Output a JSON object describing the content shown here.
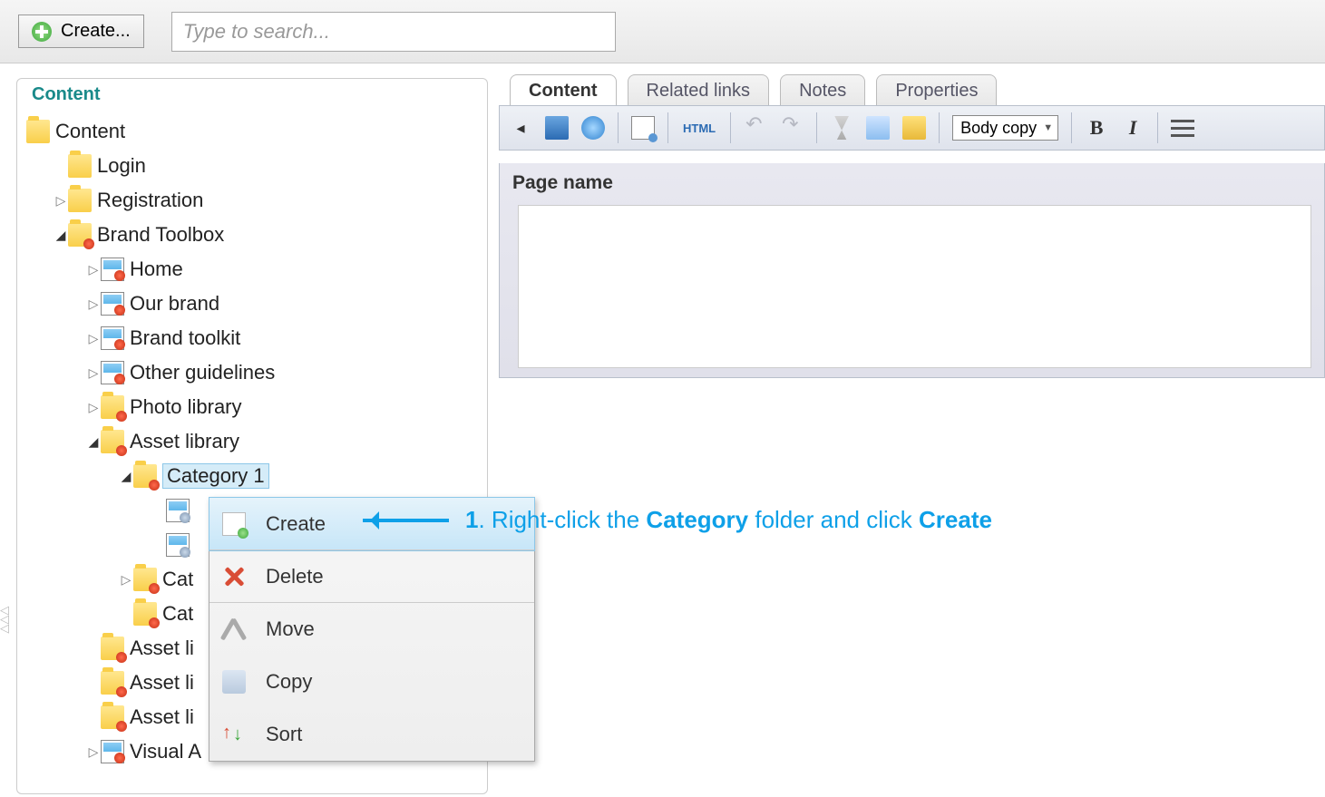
{
  "topbar": {
    "create_label": "Create...",
    "search_placeholder": "Type to search..."
  },
  "left_panel": {
    "title": "Content"
  },
  "tree": {
    "root": "Content",
    "items": [
      {
        "label": "Login",
        "indent": 1,
        "icon": "folder",
        "arrow": "none"
      },
      {
        "label": "Registration",
        "indent": 1,
        "icon": "folder",
        "arrow": "collapsed"
      },
      {
        "label": "Brand Toolbox",
        "indent": 1,
        "icon": "folder-red",
        "arrow": "expanded"
      },
      {
        "label": "Home",
        "indent": 2,
        "icon": "pic",
        "arrow": "collapsed"
      },
      {
        "label": "Our brand",
        "indent": 2,
        "icon": "pic",
        "arrow": "collapsed"
      },
      {
        "label": "Brand toolkit",
        "indent": 2,
        "icon": "pic",
        "arrow": "collapsed"
      },
      {
        "label": "Other guidelines",
        "indent": 2,
        "icon": "pic",
        "arrow": "collapsed"
      },
      {
        "label": "Photo library",
        "indent": 2,
        "icon": "folder-red",
        "arrow": "collapsed"
      },
      {
        "label": "Asset library",
        "indent": 2,
        "icon": "folder-red",
        "arrow": "expanded"
      },
      {
        "label": "Category 1",
        "indent": 3,
        "icon": "folder-red",
        "arrow": "expanded",
        "selected": true
      },
      {
        "label": "",
        "indent": 4,
        "icon": "pic-lock",
        "arrow": "none"
      },
      {
        "label": "",
        "indent": 4,
        "icon": "pic-lock",
        "arrow": "none"
      },
      {
        "label": "Cat",
        "indent": 3,
        "icon": "folder-red",
        "arrow": "collapsed"
      },
      {
        "label": "Cat",
        "indent": 3,
        "icon": "folder-red",
        "arrow": "none"
      },
      {
        "label": "Asset li",
        "indent": 2,
        "icon": "folder-red",
        "arrow": "none"
      },
      {
        "label": "Asset li",
        "indent": 2,
        "icon": "folder-red",
        "arrow": "none"
      },
      {
        "label": "Asset li",
        "indent": 2,
        "icon": "folder-red",
        "arrow": "none"
      },
      {
        "label": "Visual A",
        "indent": 2,
        "icon": "pic",
        "arrow": "collapsed"
      }
    ]
  },
  "tabs": [
    "Content",
    "Related links",
    "Notes",
    "Properties"
  ],
  "active_tab": 0,
  "toolbar": {
    "style_option": "Body copy",
    "html_label": "HTML",
    "bold_label": "B",
    "italic_label": "I"
  },
  "form": {
    "page_name_label": "Page name"
  },
  "context_menu": {
    "items": [
      "Create",
      "Delete",
      "Move",
      "Copy",
      "Sort"
    ],
    "highlighted": 0
  },
  "annotation": {
    "prefix": "1",
    "text_a": ". Right-click the ",
    "bold_a": "Category",
    "text_b": " folder and click ",
    "bold_b": "Create"
  }
}
